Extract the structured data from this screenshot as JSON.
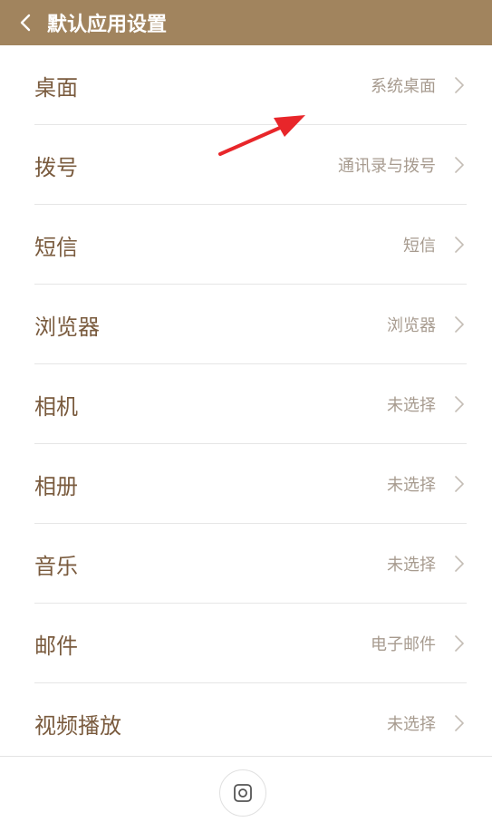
{
  "header": {
    "back_icon": "chevron-left-icon",
    "title": "默认应用设置",
    "background_color": "#a1845e"
  },
  "rows": [
    {
      "label": "桌面",
      "value": "系统桌面"
    },
    {
      "label": "拨号",
      "value": "通讯录与拨号"
    },
    {
      "label": "短信",
      "value": "短信"
    },
    {
      "label": "浏览器",
      "value": "浏览器"
    },
    {
      "label": "相机",
      "value": "未选择"
    },
    {
      "label": "相册",
      "value": "未选择"
    },
    {
      "label": "音乐",
      "value": "未选择"
    },
    {
      "label": "邮件",
      "value": "电子邮件"
    },
    {
      "label": "视频播放",
      "value": "未选择"
    }
  ],
  "bottom_bar": {
    "home_icon": "home-square-icon"
  },
  "annotation": {
    "icon": "red-arrow-annotation",
    "color": "#e8262a"
  }
}
